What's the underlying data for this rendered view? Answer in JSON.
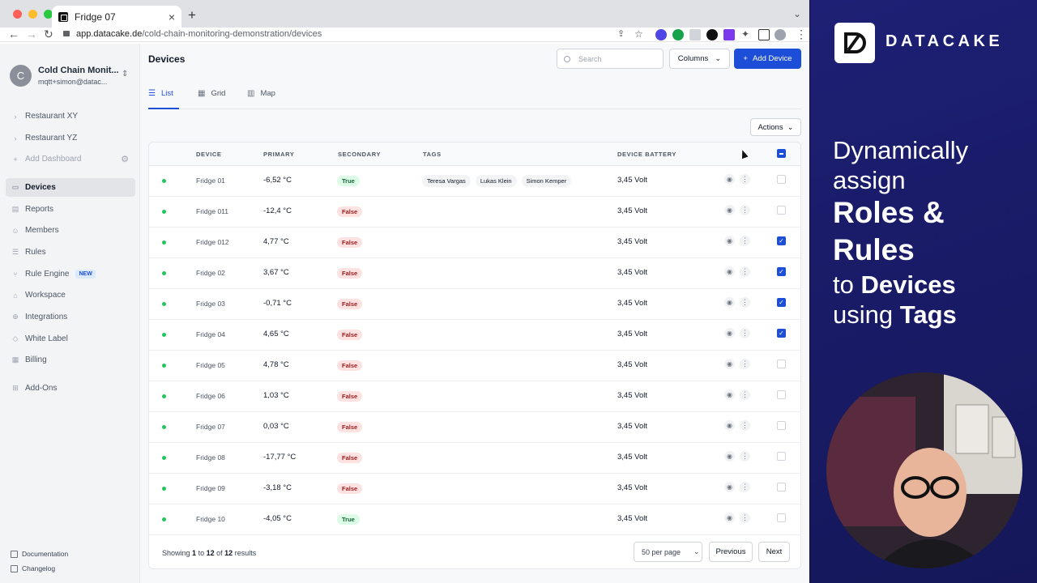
{
  "browser": {
    "tab_title": "Fridge 07",
    "url_host": "app.datacake.de",
    "url_path": "/cold-chain-monitoring-demonstration/devices"
  },
  "sidebar": {
    "account_initial": "C",
    "account_name": "Cold Chain Monit...",
    "account_email": "mqtt+simon@datac...",
    "dashboards": [
      "Restaurant XY",
      "Restaurant YZ"
    ],
    "add_dashboard": "Add Dashboard",
    "items": [
      {
        "label": "Devices",
        "icon": "devices-icon"
      },
      {
        "label": "Reports",
        "icon": "reports-icon"
      },
      {
        "label": "Members",
        "icon": "members-icon"
      },
      {
        "label": "Rules",
        "icon": "rules-icon"
      },
      {
        "label": "Rule Engine",
        "icon": "rule-engine-icon"
      },
      {
        "label": "Workspace",
        "icon": "workspace-icon"
      },
      {
        "label": "Integrations",
        "icon": "integrations-icon"
      },
      {
        "label": "White Label",
        "icon": "tag-icon"
      },
      {
        "label": "Billing",
        "icon": "billing-icon"
      },
      {
        "label": "Add-Ons",
        "icon": "addons-icon"
      }
    ],
    "new_badge": "NEW",
    "footer": [
      "Documentation",
      "Changelog"
    ]
  },
  "main": {
    "title": "Devices",
    "search_placeholder": "Search",
    "columns_label": "Columns",
    "add_device_label": "Add Device",
    "tabs": [
      "List",
      "Grid",
      "Map"
    ],
    "actions_label": "Actions",
    "headers": [
      "DEVICE",
      "PRIMARY",
      "SECONDARY",
      "TAGS",
      "DEVICE BATTERY"
    ],
    "rows": [
      {
        "device": "Fridge 01",
        "primary": "-6,52 °C",
        "secondary": "True",
        "tags": [
          "Teresa Vargas",
          "Lukas Klein",
          "Simon Kemper"
        ],
        "battery": "3,45 Volt",
        "checked": false
      },
      {
        "device": "Fridge 011",
        "primary": "-12,4 °C",
        "secondary": "False",
        "tags": [],
        "battery": "3,45 Volt",
        "checked": false
      },
      {
        "device": "Fridge 012",
        "primary": "4,77 °C",
        "secondary": "False",
        "tags": [],
        "battery": "3,45 Volt",
        "checked": true
      },
      {
        "device": "Fridge 02",
        "primary": "3,67 °C",
        "secondary": "False",
        "tags": [],
        "battery": "3,45 Volt",
        "checked": true
      },
      {
        "device": "Fridge 03",
        "primary": "-0,71 °C",
        "secondary": "False",
        "tags": [],
        "battery": "3,45 Volt",
        "checked": true
      },
      {
        "device": "Fridge 04",
        "primary": "4,65 °C",
        "secondary": "False",
        "tags": [],
        "battery": "3,45 Volt",
        "checked": true
      },
      {
        "device": "Fridge 05",
        "primary": "4,78 °C",
        "secondary": "False",
        "tags": [],
        "battery": "3,45 Volt",
        "checked": false
      },
      {
        "device": "Fridge 06",
        "primary": "1,03 °C",
        "secondary": "False",
        "tags": [],
        "battery": "3,45 Volt",
        "checked": false
      },
      {
        "device": "Fridge 07",
        "primary": "0,03 °C",
        "secondary": "False",
        "tags": [],
        "battery": "3,45 Volt",
        "checked": false
      },
      {
        "device": "Fridge 08",
        "primary": "-17,77 °C",
        "secondary": "False",
        "tags": [],
        "battery": "3,45 Volt",
        "checked": false
      },
      {
        "device": "Fridge 09",
        "primary": "-3,18 °C",
        "secondary": "False",
        "tags": [],
        "battery": "3,45 Volt",
        "checked": false
      },
      {
        "device": "Fridge 10",
        "primary": "-4,05 °C",
        "secondary": "True",
        "tags": [],
        "battery": "3,45 Volt",
        "checked": false
      }
    ],
    "footer": {
      "showing": "Showing",
      "from": "1",
      "to_word": "to",
      "to": "12",
      "of_word": "of",
      "total": "12",
      "results": "results",
      "per_page": "50 per page",
      "prev": "Previous",
      "next": "Next"
    }
  },
  "promo": {
    "brand": "DATACAKE",
    "lines": [
      "Dynamically",
      "assign",
      "Roles &",
      "Rules",
      "to",
      "Devices",
      "using",
      "Tags"
    ]
  },
  "colors": {
    "accent": "#1d4ed8",
    "status_online": "#22c55e",
    "background": "#1c1f6e"
  }
}
